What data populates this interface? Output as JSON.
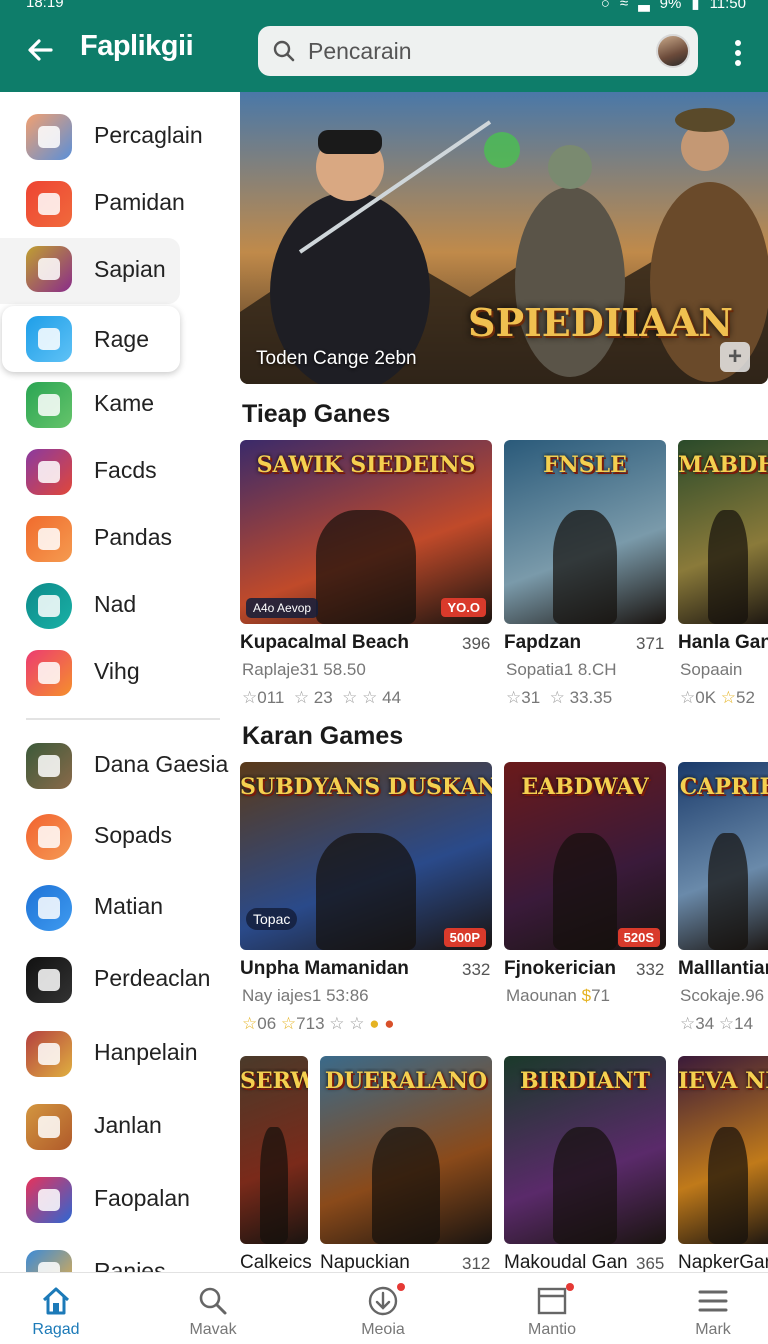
{
  "status": {
    "time": "18:19",
    "battery": "9%",
    "clock_right": "11:50"
  },
  "appbar": {
    "title": "Faplikgii",
    "search_placeholder": "Pencarain",
    "back_icon": "arrow-left-icon",
    "more_icon": "more-vert-icon"
  },
  "sidebar": {
    "items": [
      {
        "label": "Percaglain",
        "colors": [
          "#f2a070",
          "#5a8fd8"
        ]
      },
      {
        "label": "Pamidan",
        "colors": [
          "#ee4433",
          "#f06a3c"
        ]
      },
      {
        "label": "Sapian",
        "colors": [
          "#c0a030",
          "#8a2c8a"
        ]
      },
      {
        "label": "Rage",
        "colors": [
          "#1e9ee8",
          "#5fc2f6"
        ]
      },
      {
        "label": "Kame",
        "colors": [
          "#2aa553",
          "#66c46b"
        ]
      },
      {
        "label": "Facds",
        "colors": [
          "#8a3aa0",
          "#e0473a"
        ]
      },
      {
        "label": "Pandas",
        "colors": [
          "#f06b2d",
          "#f59b50"
        ]
      },
      {
        "label": "Nad",
        "colors": [
          "#0d8a8a",
          "#1ab1a6"
        ]
      },
      {
        "label": "Vihg",
        "colors": [
          "#ec3b71",
          "#f5902c"
        ]
      },
      {
        "label": "Dana Gaesia",
        "colors": [
          "#3b5a3a",
          "#8a6a4a"
        ]
      },
      {
        "label": "Sopads",
        "colors": [
          "#f2622f",
          "#f59a55"
        ]
      },
      {
        "label": "Matian",
        "colors": [
          "#1e72d6",
          "#3f9bf0"
        ]
      },
      {
        "label": "Perdeaclan",
        "colors": [
          "#111111",
          "#333333"
        ]
      },
      {
        "label": "Hanpelain",
        "colors": [
          "#b44040",
          "#e0b040"
        ]
      },
      {
        "label": "Janlan",
        "colors": [
          "#d39640",
          "#b05a2a"
        ]
      },
      {
        "label": "Faopalan",
        "colors": [
          "#e8325a",
          "#2d67d3"
        ]
      },
      {
        "label": "Ranies",
        "colors": [
          "#3a8ad8",
          "#f0b040"
        ]
      }
    ]
  },
  "hero": {
    "caption": "Toden Cange 2ebn",
    "logo_text": "SPIEDIIAAN",
    "add_icon": "plus-icon"
  },
  "sections": [
    {
      "title": "Tieap Ganes",
      "cards": [
        {
          "name": "Kupacalmal Beach",
          "count": "396",
          "sub": "Raplaje31 58.50",
          "stars": [
            "011",
            "23",
            "44"
          ],
          "badge": "YO.O",
          "tag": "A4o Aevop",
          "art_text": "SAWIK SIEDEINS",
          "colors": [
            "#3a2a6a",
            "#c04a2a"
          ]
        },
        {
          "name": "Fapdzan",
          "count": "371",
          "sub": "Sopatia1 8.CH",
          "stars": [
            "31",
            "33.35"
          ],
          "art_text": "FNSLE",
          "colors": [
            "#2a5a7a",
            "#7a9aaa"
          ]
        },
        {
          "name": "Hanla Gan",
          "count": "",
          "sub": "Sopaain",
          "stars": [
            "0K",
            "52"
          ],
          "art_text": "MABDHAK",
          "colors": [
            "#2a4a2a",
            "#8a7a3a"
          ]
        }
      ]
    },
    {
      "title": "Karan Games",
      "cards": [
        {
          "name": "Unpha Mamanidan",
          "count": "332",
          "sub": "Nay iajes1 53:86",
          "stars": [
            "06",
            "713"
          ],
          "badge": "500P",
          "tag": "Topac",
          "art_text": "SUBDYANS DUSKAN",
          "colors": [
            "#5a3a1a",
            "#2a4a8a"
          ]
        },
        {
          "name": "Fjnokerician",
          "count": "332",
          "sub": "Maounan",
          "stars": [
            "71"
          ],
          "badge": "520S",
          "art_text": "EABDWAV",
          "colors": [
            "#6a1a1a",
            "#3a1a3a"
          ]
        },
        {
          "name": "Malllantian",
          "count": "",
          "sub": "Scokaje.96",
          "stars": [
            "34",
            "14"
          ],
          "art_text": "CAPRIE",
          "colors": [
            "#1a3a6a",
            "#6a8aaa"
          ]
        }
      ]
    },
    {
      "title": "",
      "cards": [
        {
          "name": "Calkeics",
          "count": "",
          "art_text": "SERWAN",
          "colors": [
            "#4a3a2a",
            "#7a2a1a"
          ]
        },
        {
          "name": "Napuckian",
          "count": "312",
          "art_text": "DUERALANO",
          "colors": [
            "#3a6a8a",
            "#8a4a1a"
          ]
        },
        {
          "name": "Makoudal Gan",
          "count": "365",
          "art_text": "BIRDIANT",
          "colors": [
            "#1a3a2a",
            "#5a2a6a"
          ]
        },
        {
          "name": "NapkerGan",
          "count": "",
          "art_text": "IEVA NENE",
          "colors": [
            "#3a1a3a",
            "#c07a1a"
          ]
        }
      ]
    }
  ],
  "bottomnav": [
    {
      "label": "Ragad",
      "icon": "home-icon",
      "active": true,
      "dot": false
    },
    {
      "label": "Mavak",
      "icon": "search-icon",
      "active": false,
      "dot": false
    },
    {
      "label": "Meoia",
      "icon": "download-icon",
      "active": false,
      "dot": true
    },
    {
      "label": "Mantio",
      "icon": "window-icon",
      "active": false,
      "dot": true
    },
    {
      "label": "Mark",
      "icon": "menu-icon",
      "active": false,
      "dot": false
    }
  ]
}
